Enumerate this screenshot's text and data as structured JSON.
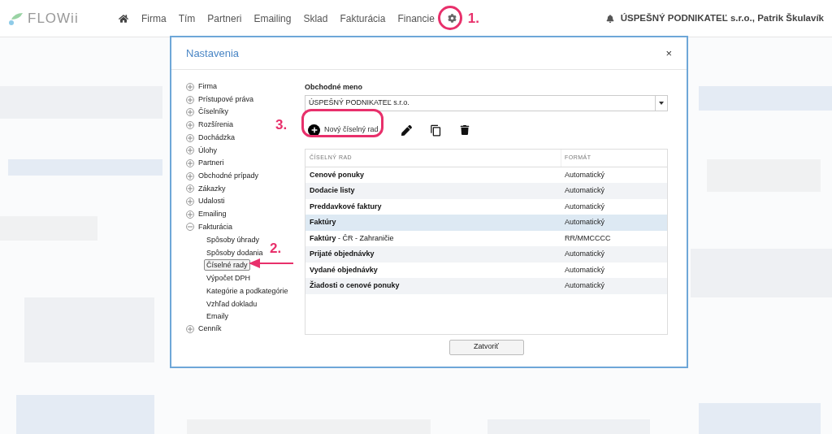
{
  "topbar": {
    "logo": "FLOWii",
    "nav": [
      "Firma",
      "Tím",
      "Partneri",
      "Emailing",
      "Sklad",
      "Fakturácia",
      "Financie"
    ],
    "user": "ÚSPEŠNÝ PODNIKATEĽ s.r.o., Patrik Škulavík"
  },
  "dialog": {
    "title": "Nastavenia",
    "close": "×",
    "tree": [
      {
        "label": "Firma",
        "expanded": false
      },
      {
        "label": "Prístupové práva",
        "expanded": false
      },
      {
        "label": "Číselníky",
        "expanded": false
      },
      {
        "label": "Rozšírenia",
        "expanded": false
      },
      {
        "label": "Dochádzka",
        "expanded": false
      },
      {
        "label": "Úlohy",
        "expanded": false
      },
      {
        "label": "Partneri",
        "expanded": false
      },
      {
        "label": "Obchodné prípady",
        "expanded": false
      },
      {
        "label": "Zákazky",
        "expanded": false
      },
      {
        "label": "Udalosti",
        "expanded": false
      },
      {
        "label": "Emailing",
        "expanded": false
      },
      {
        "label": "Fakturácia",
        "expanded": true,
        "children": [
          {
            "label": "Spôsoby úhrady",
            "selected": false
          },
          {
            "label": "Spôsoby dodania",
            "selected": false
          },
          {
            "label": "Číselné rady",
            "selected": true
          },
          {
            "label": "Výpočet DPH",
            "selected": false
          },
          {
            "label": "Kategórie a podkategórie",
            "selected": false
          },
          {
            "label": "Vzhľad dokladu",
            "selected": false
          },
          {
            "label": "Emaily",
            "selected": false
          }
        ]
      },
      {
        "label": "Cenník",
        "expanded": false
      }
    ],
    "company_field": {
      "label": "Obchodné meno",
      "value": "ÚSPEŠNÝ PODNIKATEĽ s.r.o."
    },
    "new_button": "Nový číselný rad",
    "table": {
      "columns": [
        "ČÍSELNÝ RAD",
        "FORMÁT"
      ],
      "rows": [
        {
          "kind": "main",
          "name": "Cenové ponuky",
          "format": "Automatický",
          "selected": false
        },
        {
          "kind": "main",
          "name": "Dodacie listy",
          "format": "Automatický",
          "selected": false
        },
        {
          "kind": "main",
          "name": "Preddavkové faktury",
          "format": "Automatický",
          "selected": false
        },
        {
          "kind": "main",
          "name": "Faktúry",
          "format": "Automatický",
          "selected": true
        },
        {
          "kind": "variant",
          "name": "**Faktúry** - ČR - Zahraničie",
          "format": "RR/MMCCCC",
          "selected": false
        },
        {
          "kind": "main",
          "name": "Prijaté objednávky",
          "format": "Automatický",
          "selected": false
        },
        {
          "kind": "main",
          "name": "Vydané objednávky",
          "format": "Automatický",
          "selected": false
        },
        {
          "kind": "main",
          "name": "Žiadosti o cenové ponuky",
          "format": "Automatický",
          "selected": false
        }
      ]
    },
    "close_button": "Zatvoriť"
  },
  "annotations": [
    "1.",
    "2.",
    "3."
  ]
}
